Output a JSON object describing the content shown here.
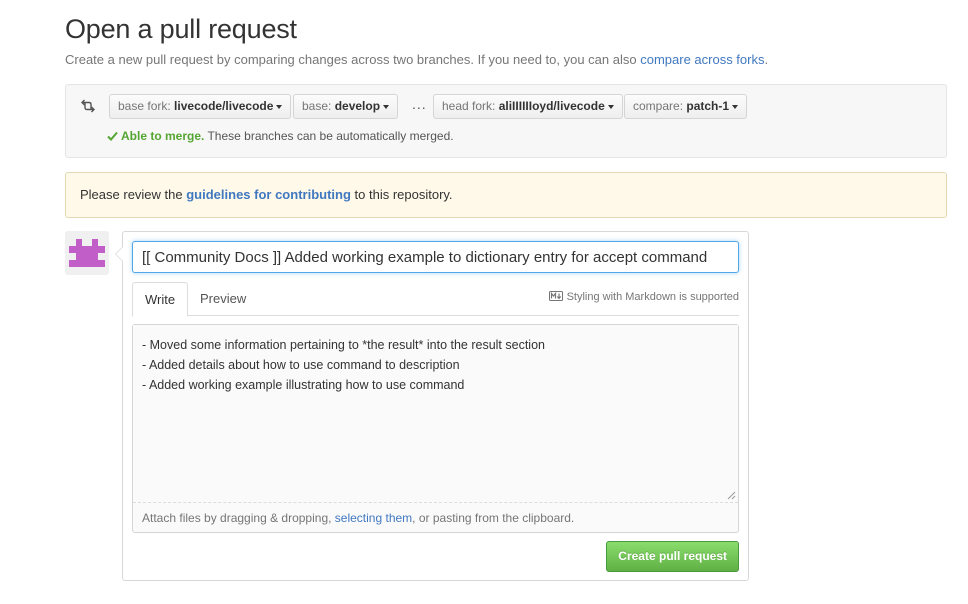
{
  "header": {
    "title": "Open a pull request",
    "subtitle_prefix": "Create a new pull request by comparing changes across two branches. If you need to, you can also ",
    "compare_forks_link": "compare across forks",
    "subtitle_suffix": "."
  },
  "range": {
    "compare_icon": "git-compare-icon",
    "base_fork": {
      "label": "base fork:",
      "value": "livecode/livecode"
    },
    "base": {
      "label": "base:",
      "value": "develop"
    },
    "ellipsis": "...",
    "head_fork": {
      "label": "head fork:",
      "value": "aliIIIIIIoyd/livecode"
    },
    "compare": {
      "label": "compare:",
      "value": "patch-1"
    },
    "merge_status_ok": "Able to merge.",
    "merge_status_text": " These branches can be automatically merged."
  },
  "flash": {
    "prefix": "Please review the ",
    "link": "guidelines for contributing",
    "suffix": " to this repository."
  },
  "form": {
    "title_value": "[[ Community Docs ]] Added working example to dictionary entry for accept command",
    "tabs": [
      "Write",
      "Preview"
    ],
    "markdown_hint": "Styling with Markdown is supported",
    "body_value": "- Moved some information pertaining to *the result* into the result section\n- Added details about how to use command to description\n- Added working example illustrating how to use command",
    "attach_prefix": "Attach files by dragging & dropping, ",
    "attach_link": "selecting them",
    "attach_suffix": ", or pasting from the clipboard.",
    "submit_label": "Create pull request"
  },
  "colors": {
    "link": "#4078c0",
    "success": "#55a532",
    "submit": "#60b044",
    "avatar": "#c25ec7"
  }
}
